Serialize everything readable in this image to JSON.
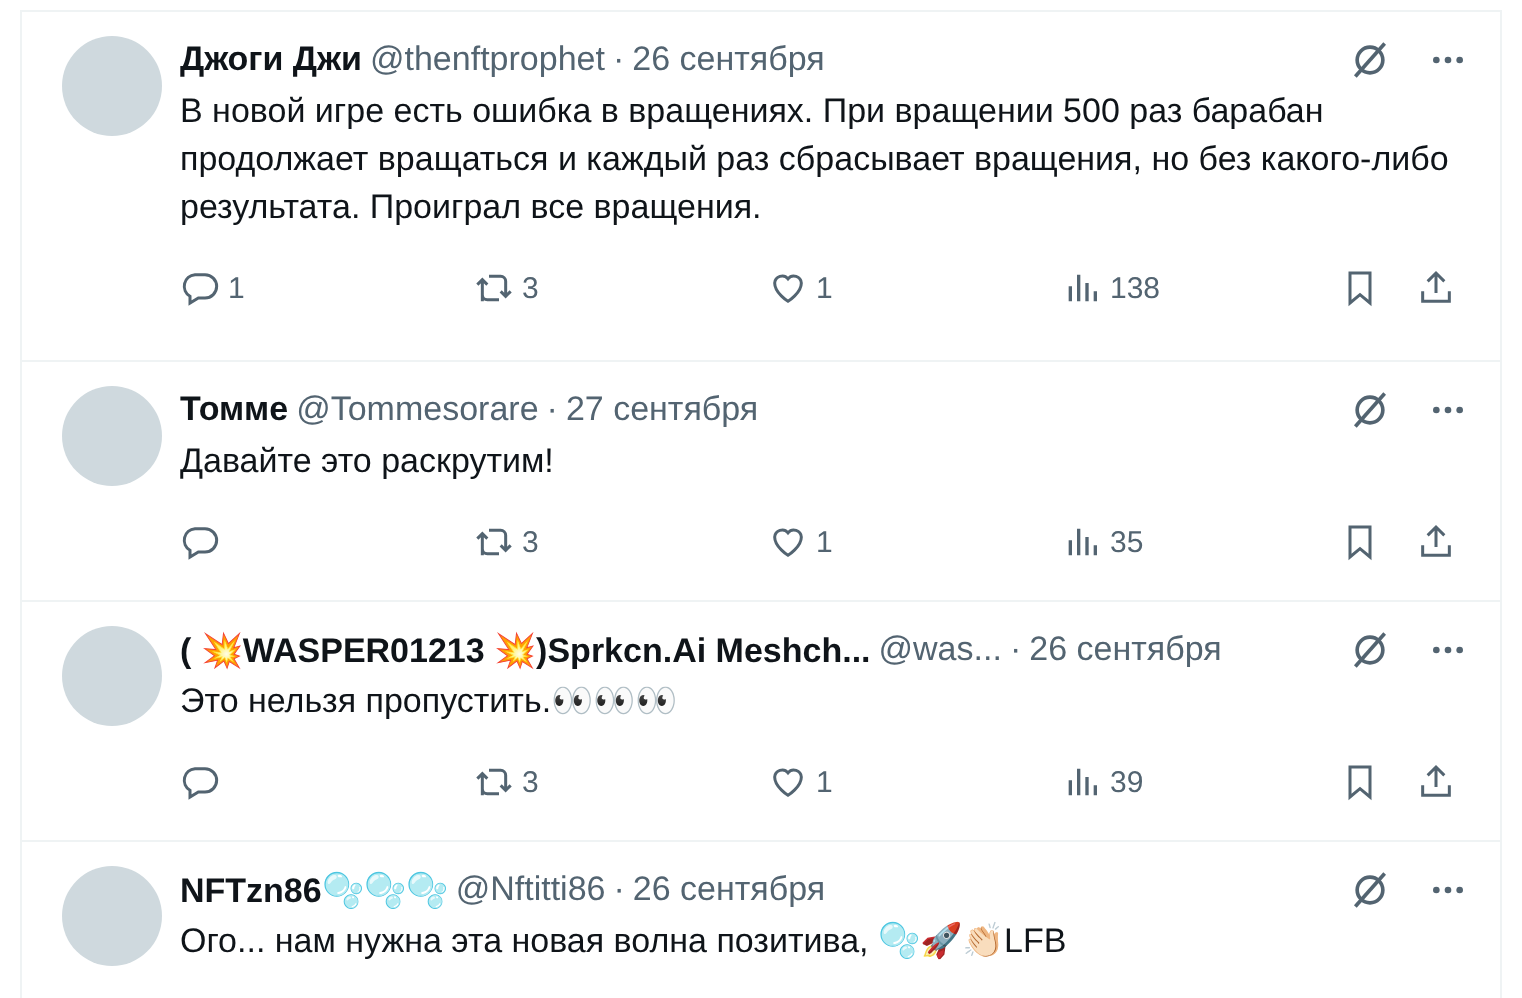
{
  "tweets": [
    {
      "name": "Джоги Джи",
      "handle": "@thenftprophet",
      "separator": "·",
      "date": "26 сентября",
      "text": "В новой игре есть ошибка в вращениях. При вращении 500 раз барабан продолжает вращаться и каждый раз сбрасывает вращения, но без какого-либо результата. Проиграл все вращения.",
      "actions": {
        "replies": "1",
        "reposts": "3",
        "likes": "1",
        "views": "138"
      }
    },
    {
      "name": "Томме",
      "handle": "@Tommesorare",
      "separator": "·",
      "date": "27 сентября",
      "text": "Давайте это раскрутим!",
      "actions": {
        "reposts": "3",
        "likes": "1",
        "views": "35"
      }
    },
    {
      "name": "( 💥WASPER01213 💥)Sprkcn.Ai Meshch...",
      "handle": "@was...",
      "separator": "·",
      "date": "26 сентября",
      "text": "Это нельзя пропустить.👀👀👀",
      "actions": {
        "reposts": "3",
        "likes": "1",
        "views": "39"
      }
    },
    {
      "name": "NFTzn86🫧🫧🫧",
      "handle": "@Nftitti86",
      "separator": "·",
      "date": "26 сентября",
      "text": "Ого... нам нужна эта новая волна позитива, 🫧🚀👏🏻LFB"
    }
  ]
}
